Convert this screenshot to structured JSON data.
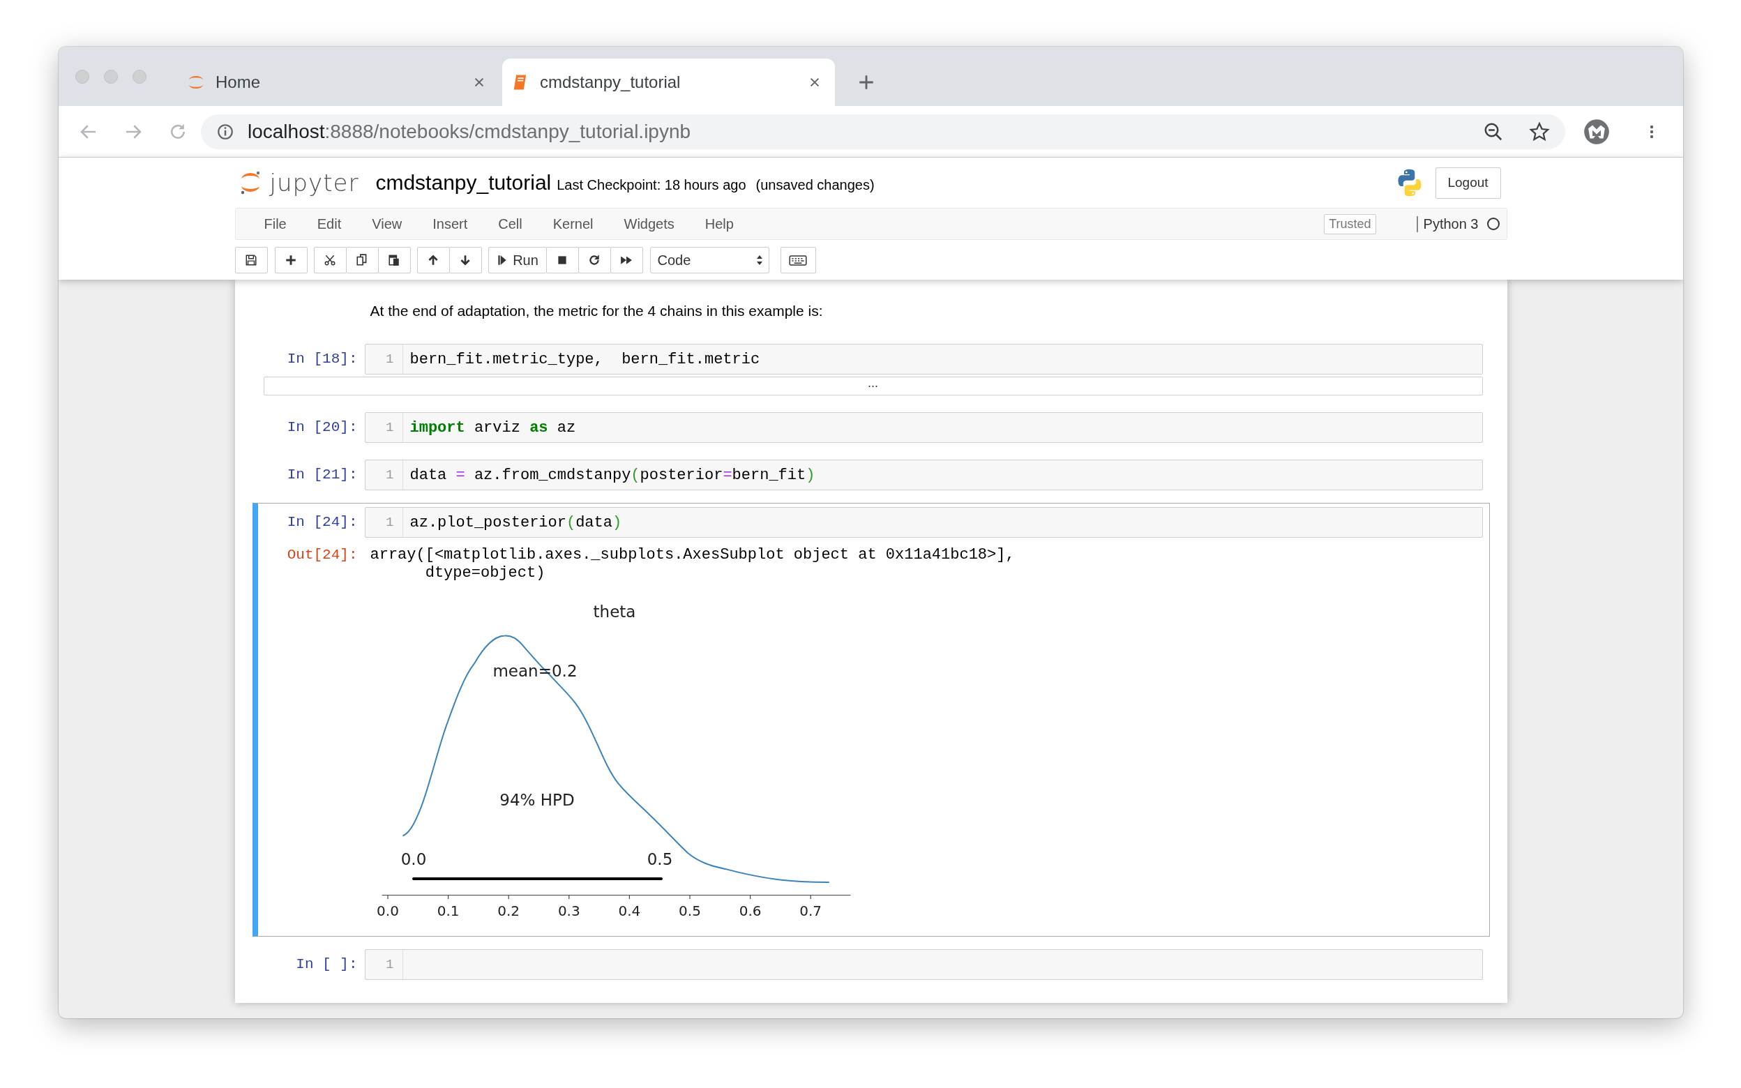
{
  "browser": {
    "tabs": [
      {
        "title": "Home",
        "selected": false
      },
      {
        "title": "cmdstanpy_tutorial",
        "selected": true
      }
    ],
    "url": {
      "host": "localhost",
      "path": ":8888/notebooks/cmdstanpy_tutorial.ipynb"
    }
  },
  "header": {
    "logo_text": "jupyter",
    "notebook_name": "cmdstanpy_tutorial",
    "checkpoint": "Last Checkpoint: 18 hours ago",
    "autosave_status": "(unsaved changes)",
    "logout": "Logout"
  },
  "menu": {
    "items": [
      "File",
      "Edit",
      "View",
      "Insert",
      "Cell",
      "Kernel",
      "Widgets",
      "Help"
    ],
    "trusted": "Trusted",
    "kernel": {
      "name": "Python 3",
      "busy": false
    }
  },
  "toolbar": {
    "run": "Run",
    "cell_type": "Code"
  },
  "cells": [
    {
      "kind": "markdown",
      "text": "At the end of adaptation, the metric for the 4 chains in this example is:"
    },
    {
      "kind": "code",
      "prompt": "In [18]:",
      "selected": false,
      "lines": [
        {
          "number": "1",
          "tokens": [
            {
              "kind": "plain",
              "text": "bern_fit.metric_type,  bern_fit.metric"
            }
          ]
        }
      ],
      "collapsed_output": "..."
    },
    {
      "kind": "code",
      "prompt": "In [20]:",
      "selected": false,
      "lines": [
        {
          "number": "1",
          "tokens": [
            {
              "kind": "keyword",
              "text": "import"
            },
            {
              "kind": "plain",
              "text": " arviz "
            },
            {
              "kind": "keyword",
              "text": "as"
            },
            {
              "kind": "plain",
              "text": " az"
            }
          ]
        }
      ]
    },
    {
      "kind": "code",
      "prompt": "In [21]:",
      "selected": false,
      "lines": [
        {
          "number": "1",
          "tokens": [
            {
              "kind": "plain",
              "text": "data "
            },
            {
              "kind": "operator",
              "text": "="
            },
            {
              "kind": "plain",
              "text": " az.from_cmdstanpy"
            },
            {
              "kind": "bracket",
              "text": "("
            },
            {
              "kind": "plain",
              "text": "posterior"
            },
            {
              "kind": "operator",
              "text": "="
            },
            {
              "kind": "plain",
              "text": "bern_fit"
            },
            {
              "kind": "bracket",
              "text": ")"
            }
          ]
        }
      ]
    },
    {
      "kind": "code",
      "prompt": "In [24]:",
      "selected": true,
      "lines": [
        {
          "number": "1",
          "tokens": [
            {
              "kind": "plain",
              "text": "az.plot_posterior"
            },
            {
              "kind": "bracket",
              "text": "("
            },
            {
              "kind": "plain",
              "text": "data"
            },
            {
              "kind": "bracket",
              "text": ")"
            }
          ]
        }
      ],
      "output": {
        "prompt": "Out[24]:",
        "text": "array([<matplotlib.axes._subplots.AxesSubplot object at 0x11a41bc18>],\n      dtype=object)",
        "plot": {
          "title": "theta",
          "mean_label": "mean=0.2",
          "hpd_label": "94% HPD",
          "hpd_low": "0.0",
          "hpd_high": "0.5",
          "xticks": [
            "0.0",
            "0.1",
            "0.2",
            "0.3",
            "0.4",
            "0.5",
            "0.6",
            "0.7"
          ]
        }
      }
    },
    {
      "kind": "code",
      "prompt": "In [ ]:",
      "selected": false,
      "lines": [
        {
          "number": "1"
        }
      ]
    }
  ]
}
